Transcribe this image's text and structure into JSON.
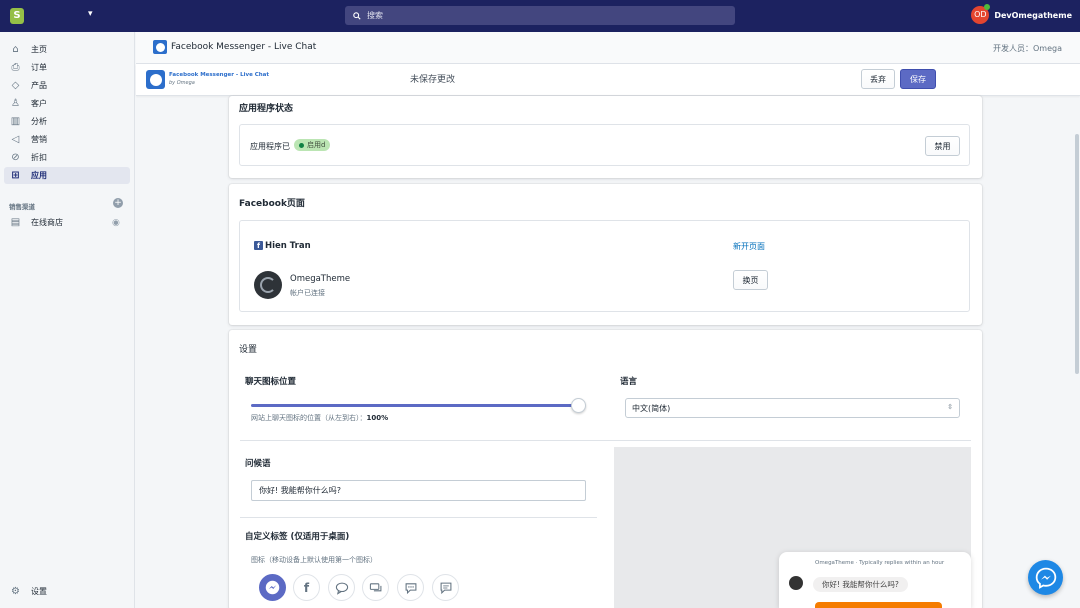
{
  "topbar": {
    "search_placeholder": "搜索",
    "store_caret": "▾",
    "user_initials": "OD",
    "user_name": "DevOmegatheme"
  },
  "sidebar": {
    "items": [
      {
        "label": "主页",
        "icon": "home-icon",
        "glyph": "⌂"
      },
      {
        "label": "订单",
        "icon": "orders-icon",
        "glyph": "⎙"
      },
      {
        "label": "产品",
        "icon": "tag-icon",
        "glyph": "◇"
      },
      {
        "label": "客户",
        "icon": "customer-icon",
        "glyph": "♙"
      },
      {
        "label": "分析",
        "icon": "analytics-icon",
        "glyph": "▥"
      },
      {
        "label": "营销",
        "icon": "marketing-icon",
        "glyph": "◁"
      },
      {
        "label": "折扣",
        "icon": "discount-icon",
        "glyph": "⊘"
      },
      {
        "label": "应用",
        "icon": "apps-icon",
        "glyph": "⊞"
      }
    ],
    "channels_title": "销售渠道",
    "online_store": "在线商店",
    "settings": "设置"
  },
  "header": {
    "title": "Facebook Messenger - Live Chat",
    "developer": "开发人员：Omega"
  },
  "savebar": {
    "brand_title": "Facebook Messenger - Live Chat",
    "brand_sub": "by Omega",
    "unsaved": "未保存更改",
    "discard": "丢弃",
    "save": "保存"
  },
  "status_card": {
    "title": "应用程序状态",
    "text": "应用程序已",
    "badge": "启用d",
    "disable": "禁用"
  },
  "fb_card": {
    "title": "Facebook页面",
    "user": "Hien Tran",
    "open_page": "新开页面",
    "page_name": "OmegaTheme",
    "page_status": "帐户已连接",
    "switch_page": "换页"
  },
  "settings_card": {
    "title": "设置",
    "position_label": "聊天图标位置",
    "position_help": "网站上聊天图标的位置（从左到右）：",
    "position_value": "100%",
    "position_fraction": 1.0,
    "language_label": "语言",
    "language_value": "中文(简体)",
    "greeting_label": "问候语",
    "greeting_value": "你好! 我能帮你什么吗?",
    "custom_label": "自定义标签 (仅适用于桌面)",
    "icon_help": "图标（移动设备上默认使用第一个图标）",
    "icons": [
      "messenger-icon",
      "facebook-icon",
      "chat-bubbles-icon",
      "chat-double-icon",
      "chat-dots-icon",
      "chat-square-icon"
    ]
  },
  "preview": {
    "header": "OmegaTheme · Typically replies within an hour",
    "bubble": "你好! 我能帮你什么吗?"
  },
  "colors": {
    "topbar": "#1c2260",
    "primary": "#5c6ac4",
    "badge": "#bbe5b3",
    "messenger": "#1e88e5"
  }
}
